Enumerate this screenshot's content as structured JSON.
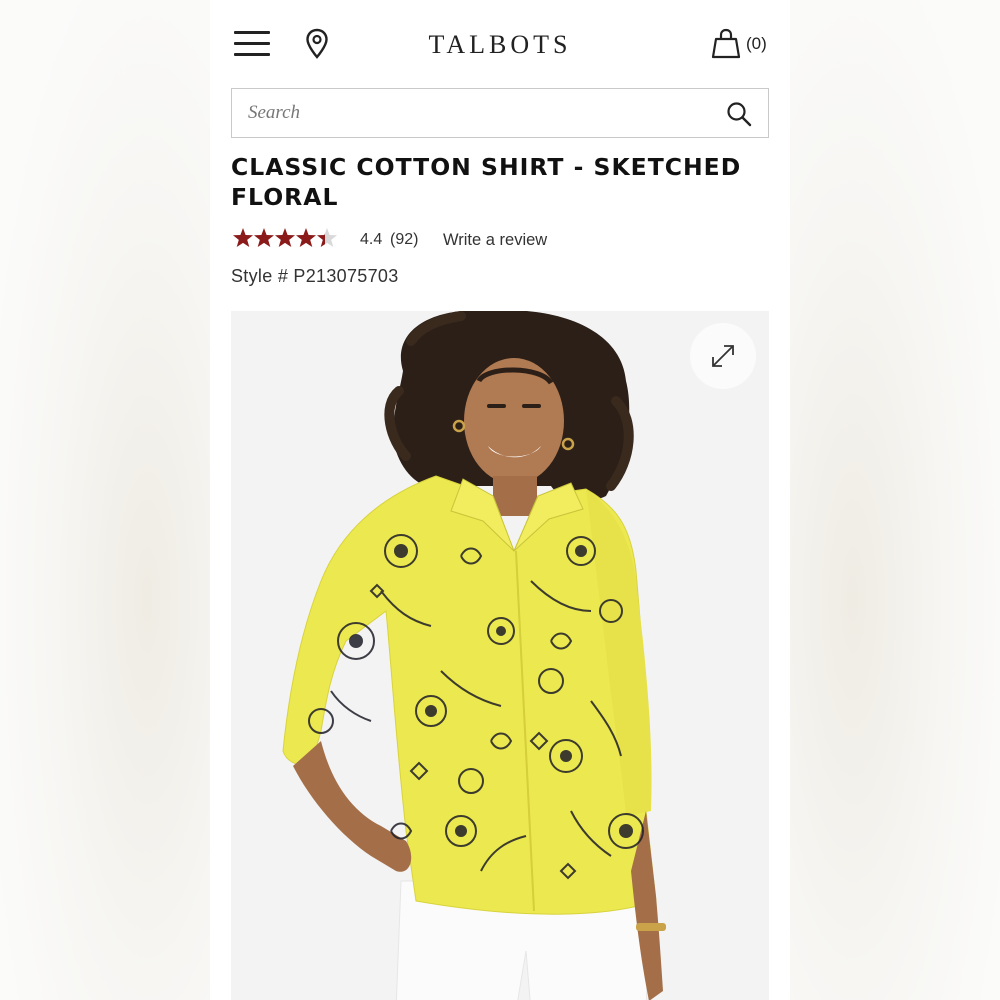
{
  "header": {
    "logo": "TALBOTS",
    "bag_count": "(0)",
    "icons": [
      "menu-icon",
      "location-pin-icon",
      "shopping-bag-icon"
    ]
  },
  "search": {
    "placeholder": "Search",
    "icon": "search-icon"
  },
  "product": {
    "title": "CLASSIC COTTON SHIRT - SKETCHED FLORAL",
    "rating": {
      "value": "4.4",
      "count": "(92)",
      "stars": 4.4,
      "max_stars": 5,
      "star_color": "#8b1a1a"
    },
    "write_review": "Write a review",
    "style_number": "Style # P213075703",
    "image": {
      "alt": "Model wearing yellow sketched floral cotton shirt with white pants",
      "expand_icon": "expand-icon",
      "shirt_color": "#ece84f",
      "background_color": "#f3f3f4"
    }
  }
}
